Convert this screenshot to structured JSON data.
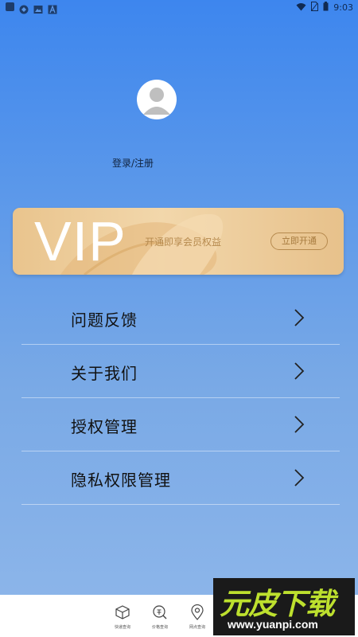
{
  "status_bar": {
    "time": "9:03"
  },
  "profile": {
    "login_label": "登录/注册"
  },
  "vip": {
    "big_text": "VIP",
    "subtitle": "开通即享会员权益",
    "button_label": "立即开通"
  },
  "menu": {
    "items": [
      {
        "label": "问题反馈"
      },
      {
        "label": "关于我们"
      },
      {
        "label": "授权管理"
      },
      {
        "label": "隐私权限管理"
      }
    ]
  },
  "bottom_nav": {
    "items": [
      {
        "label": "快递查询",
        "icon": "package-icon"
      },
      {
        "label": "价格查询",
        "icon": "price-search-icon"
      },
      {
        "label": "网点查询",
        "icon": "location-pin-icon"
      }
    ]
  },
  "watermark": {
    "title": "元皮下载",
    "url": "www.yuanpi.com"
  }
}
